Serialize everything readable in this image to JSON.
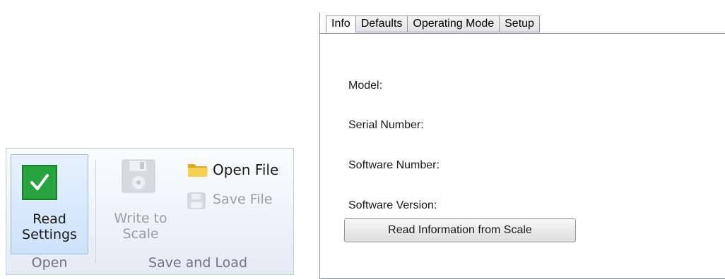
{
  "ribbon": {
    "read_settings": {
      "line1": "Read",
      "line2": "Settings",
      "icon": "check-icon"
    },
    "write_to_scale": {
      "line1": "Write to",
      "line2": "Scale",
      "icon": "disk-icon"
    },
    "open_file": {
      "label": "Open File",
      "icon": "folder-icon"
    },
    "save_file": {
      "label": "Save File",
      "icon": "small-disk-icon"
    },
    "groups": {
      "open": "Open",
      "save_and_load": "Save and Load"
    }
  },
  "tabs": [
    {
      "label": "Info",
      "active": true
    },
    {
      "label": "Defaults",
      "active": false
    },
    {
      "label": "Operating Mode",
      "active": false
    },
    {
      "label": "Setup",
      "active": false
    }
  ],
  "info": {
    "model_label": "Model:",
    "serial_label": "Serial Number:",
    "software_number_label": "Software Number:",
    "software_version_label": "Software Version:",
    "read_button": "Read Information from Scale"
  },
  "colors": {
    "check_green": "#29a33f",
    "folder_yellow": "#f2c94c",
    "disabled_text": "#9a9fa6",
    "ribbon_border": "#c3cfdf"
  }
}
